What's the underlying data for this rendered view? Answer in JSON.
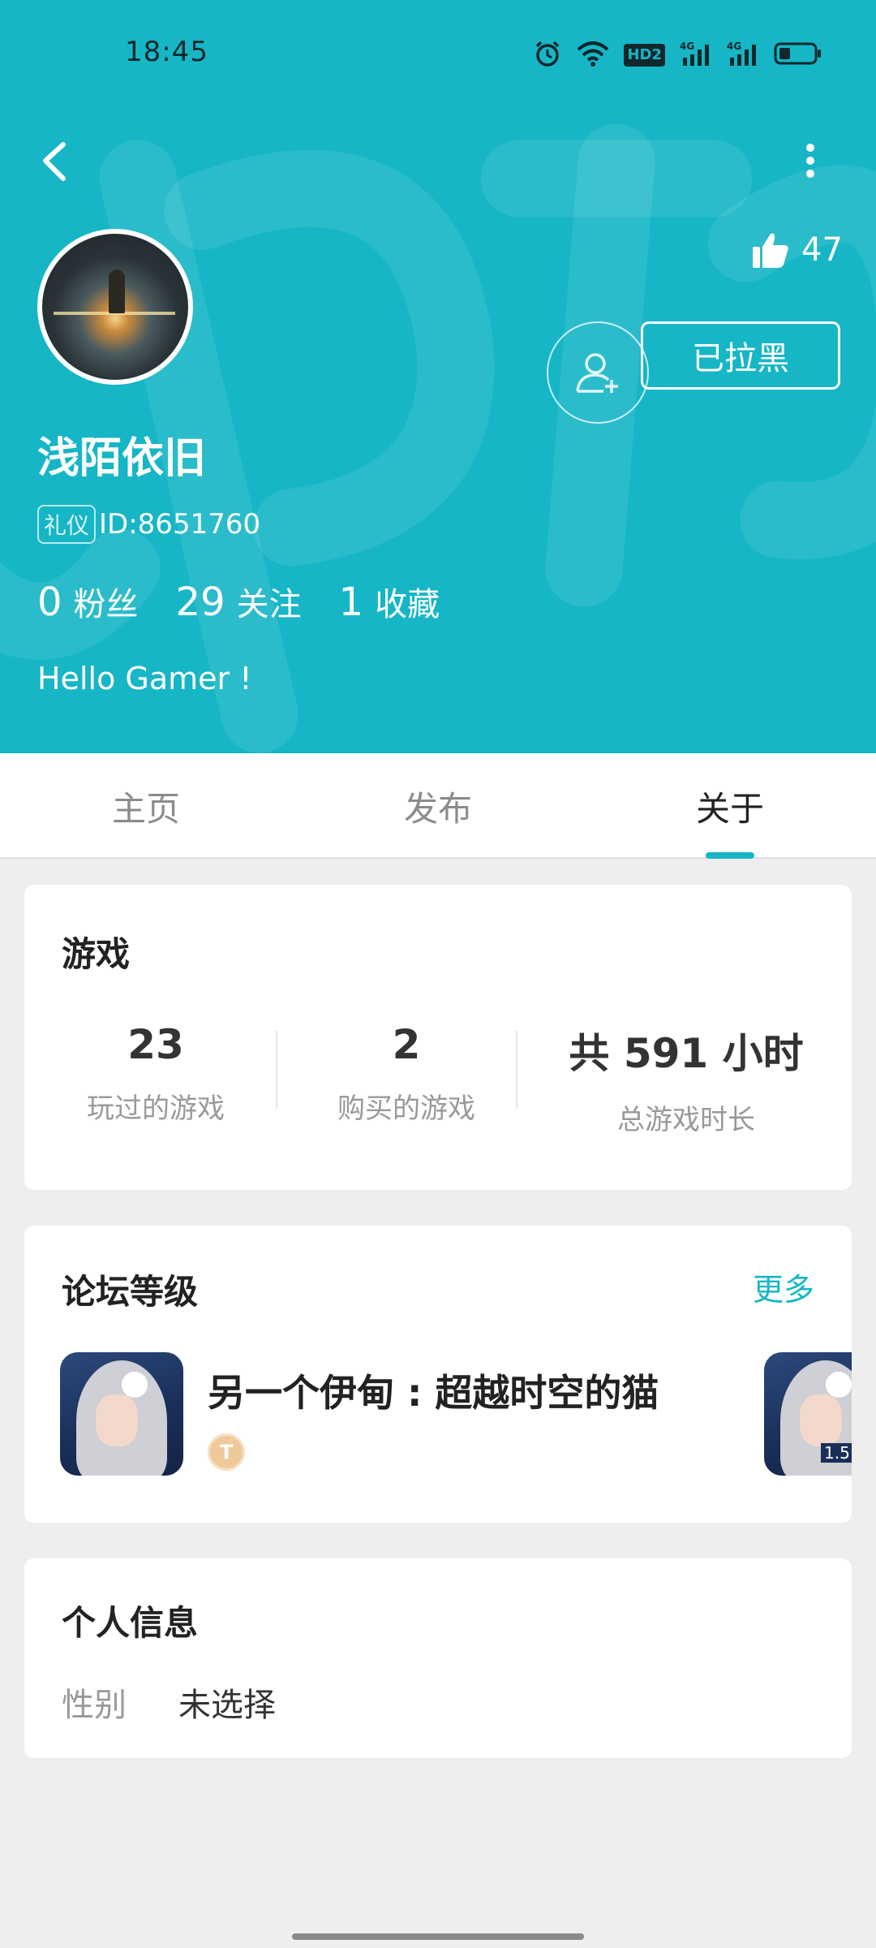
{
  "status_bar": {
    "time": "18:45",
    "icons": [
      "alarm-icon",
      "wifi-icon",
      "hd-icon",
      "signal-4g-icon",
      "signal-4g-icon",
      "battery-icon"
    ],
    "hd_text": "HD2",
    "net_text": "4G"
  },
  "colors": {
    "brand": "#16b6c6",
    "header_bg": "#16b6c6",
    "page_bg": "#eeeeee"
  },
  "header": {
    "like_count": "47",
    "username": "浅陌依旧",
    "badge": "礼仪",
    "user_id": "ID:8651760",
    "stats": [
      {
        "num": "0",
        "label": "粉丝"
      },
      {
        "num": "29",
        "label": "关注"
      },
      {
        "num": "1",
        "label": "收藏"
      }
    ],
    "bio": "Hello Gamer !",
    "block_button": "已拉黑"
  },
  "tabs": {
    "items": [
      "主页",
      "发布",
      "关于"
    ],
    "active_index": 2
  },
  "games": {
    "title": "游戏",
    "stats": [
      {
        "value": "23",
        "label": "玩过的游戏"
      },
      {
        "value": "2",
        "label": "购买的游戏"
      },
      {
        "value": "共 591 小时",
        "label": "总游戏时长"
      }
    ]
  },
  "forum": {
    "title": "论坛等级",
    "more": "更多",
    "game_name": "另一个伊甸 : 超越时空的猫",
    "level_badge": "T",
    "second_icon_label": "1.5"
  },
  "personal": {
    "title": "个人信息",
    "gender_label": "性别",
    "gender_value": "未选择"
  }
}
